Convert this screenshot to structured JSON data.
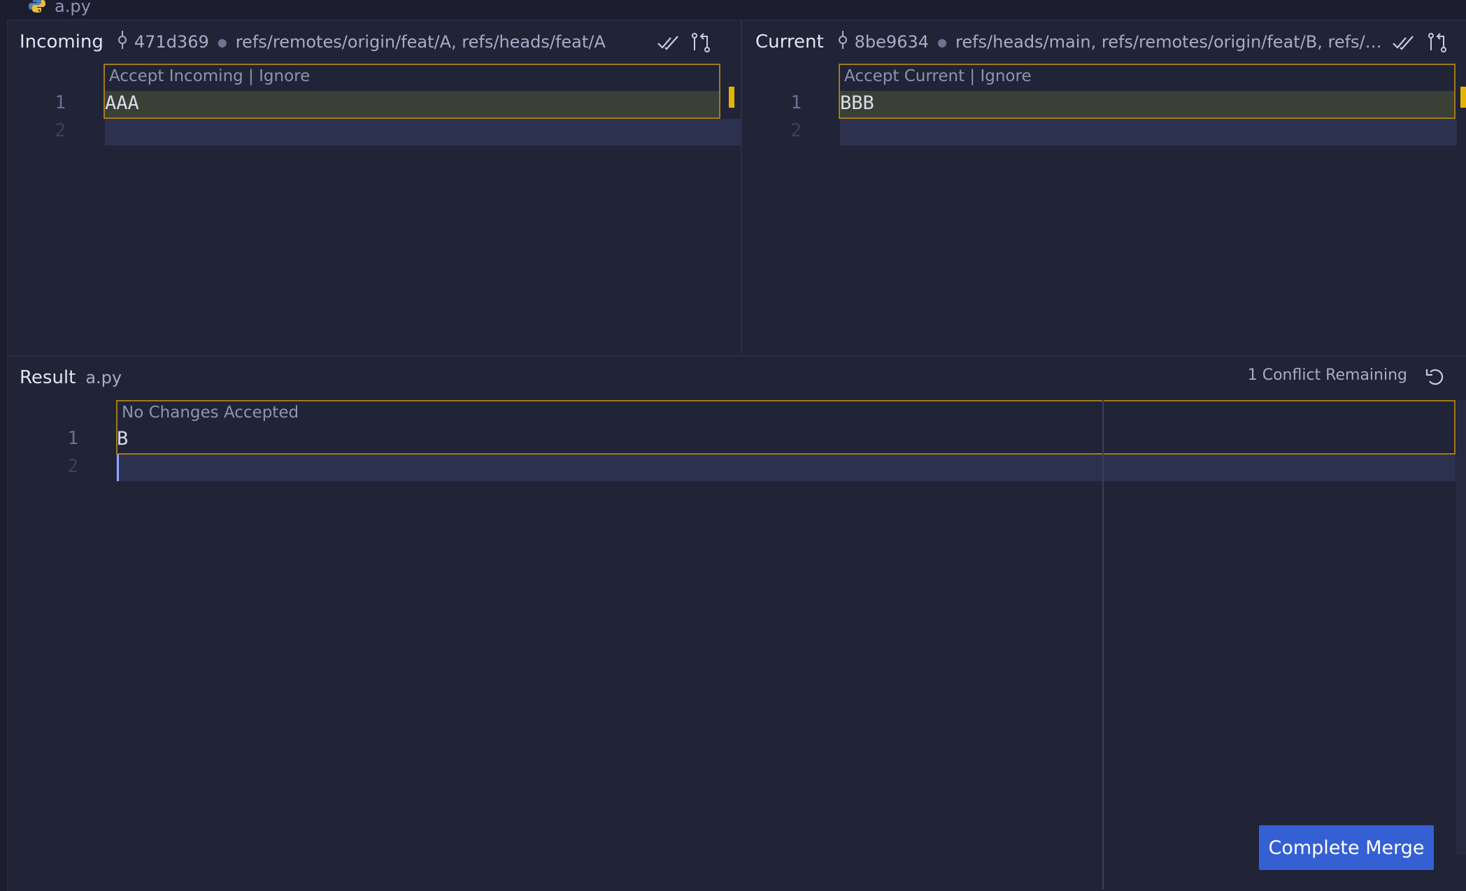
{
  "tab": {
    "filename": "a.py",
    "icon": "python-icon"
  },
  "incoming": {
    "title": "Incoming",
    "commit": "471d369",
    "refs": "refs/remotes/origin/feat/A, refs/heads/feat/A",
    "codelens": "Accept Incoming | Ignore",
    "lines": [
      "AAA",
      ""
    ],
    "line_numbers": [
      "1",
      "2"
    ]
  },
  "current": {
    "title": "Current",
    "commit": "8be9634",
    "refs": "refs/heads/main, refs/remotes/origin/feat/B, refs/hea...",
    "codelens": "Accept Current | Ignore",
    "lines": [
      "BBB",
      ""
    ],
    "line_numbers": [
      "1",
      "2"
    ]
  },
  "result": {
    "title": "Result",
    "filename": "a.py",
    "status": "1 Conflict Remaining",
    "codelens": "No Changes Accepted",
    "lines": [
      "B",
      ""
    ],
    "line_numbers": [
      "1",
      "2"
    ]
  },
  "actions": {
    "complete_merge": "Complete Merge"
  },
  "colors": {
    "background": "#212337",
    "conflict_border": "#a07a1c",
    "marker": "#e6b400",
    "primary_button": "#3560d4"
  }
}
